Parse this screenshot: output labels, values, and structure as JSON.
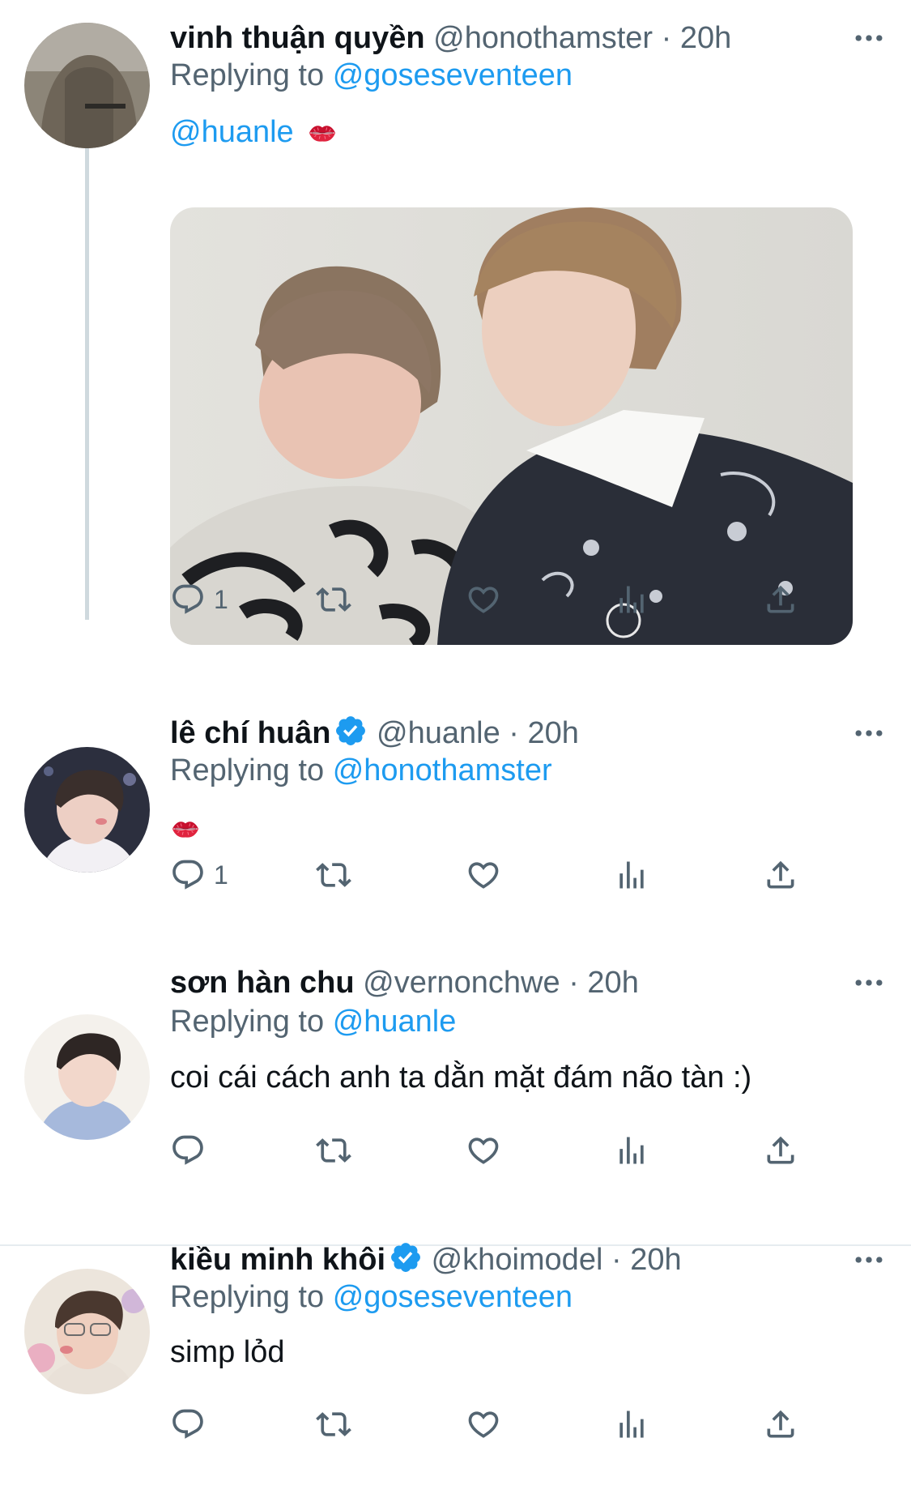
{
  "tweets": [
    {
      "name": "vinh thuận quyền",
      "handle": "@honothamster",
      "time": "20h",
      "replying_prefix": "Replying to",
      "replying_to": "@goseseventeen",
      "mention_text": "@huanle",
      "reply_count": "1",
      "verified": false
    },
    {
      "name": "lê chí huân",
      "handle": "@huanle",
      "time": "20h",
      "replying_prefix": "Replying to",
      "replying_to": "@honothamster",
      "reply_count": "1",
      "verified": true
    },
    {
      "name": "sơn hàn chu",
      "handle": "@vernonchwe",
      "time": "20h",
      "replying_prefix": "Replying to",
      "replying_to": "@huanle",
      "text": "coi cái cách anh ta dằn mặt đám não tàn :)",
      "reply_count": "",
      "verified": false
    },
    {
      "name": "kiều minh khôi",
      "handle": "@khoimodel",
      "time": "20h",
      "replying_prefix": "Replying to",
      "replying_to": "@goseseventeen",
      "text": "simp lỏd",
      "reply_count": "",
      "verified": true
    }
  ],
  "separator": "·",
  "icons": [
    "reply-icon",
    "retweet-icon",
    "like-icon",
    "analytics-icon",
    "share-icon",
    "more-icon",
    "verified-icon",
    "kiss-mark-emoji"
  ],
  "colors": {
    "accent": "#1d9bf0",
    "muted": "#536471",
    "text": "#0f1419",
    "thread_line": "#cfd9de"
  }
}
